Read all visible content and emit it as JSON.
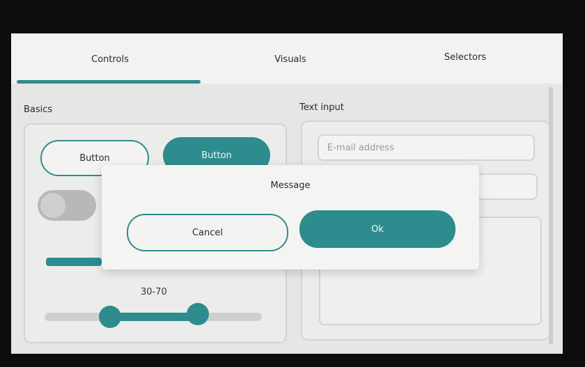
{
  "tabs": [
    {
      "label": "Controls",
      "active": true
    },
    {
      "label": "Visuals",
      "active": false
    },
    {
      "label": "Selectors",
      "active": false
    }
  ],
  "basics": {
    "title": "Basics",
    "button_outline_label": "Button",
    "button_filled_label": "Button",
    "switch_on": false,
    "range_label": "30-70",
    "range_low": 30,
    "range_high": 70
  },
  "text_input": {
    "title": "Text input",
    "email_placeholder": "E-mail address"
  },
  "dialog": {
    "title": "Message",
    "cancel_label": "Cancel",
    "ok_label": "Ok"
  },
  "colors": {
    "accent": "#2e8c8f"
  }
}
